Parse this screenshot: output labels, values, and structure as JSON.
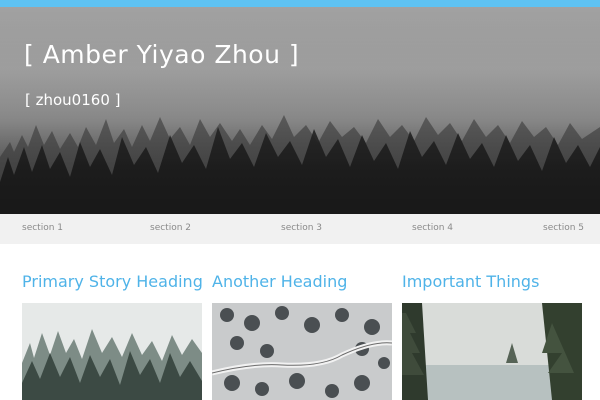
{
  "header": {
    "title": "[ Amber Yiyao Zhou ]",
    "subtitle": "[ zhou0160 ]"
  },
  "nav": {
    "items": [
      "section 1",
      "section 2",
      "section 3",
      "section 4",
      "section 5"
    ]
  },
  "columns": [
    {
      "heading": "Primary Story Heading"
    },
    {
      "heading": "Another Heading"
    },
    {
      "heading": "Important Things"
    }
  ],
  "colors": {
    "accent": "#5ec2f2",
    "heading": "#4fb3e8",
    "nav_bg": "#f1f1f1",
    "nav_text": "#8a8a8a"
  }
}
